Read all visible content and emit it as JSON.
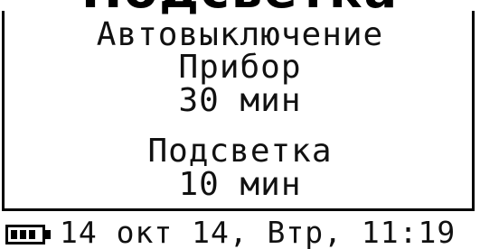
{
  "header": {
    "title": "Подсветка"
  },
  "menu": {
    "auto_off_label": "Автовыключение",
    "device_label": "Прибор",
    "device_value": "30 мин",
    "backlight_label": "Подсветка",
    "backlight_value": "10 мин"
  },
  "status_bar": {
    "battery_level": 1.0,
    "datetime": "14 окт 14, Втр, 11:19"
  }
}
